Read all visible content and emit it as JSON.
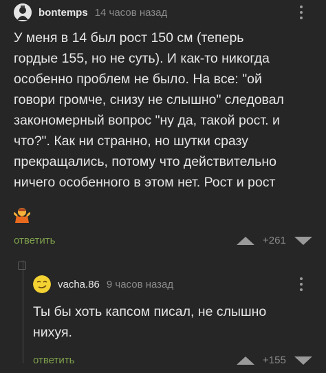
{
  "comment1": {
    "author": "bontemps",
    "time": "14 часов назад",
    "avatar_icon": "dark-character-avatar-icon",
    "lines": [
      "У меня в 14 был рост 150 см (теперь",
      "гордые 155, но не суть). И как-то никогда",
      "особенно проблем не было. На все: \"ой",
      "говори громче, снизу не слышно\" следовал",
      "закономерный вопрос \"ну да, такой рост. и",
      "что?\". Как ни странно, но шутки сразу",
      "прекращались, потому что действительно",
      "ничего особенного в этом нет. Рост и рост"
    ],
    "emoji_icon": "person-shrugging-emoji",
    "reply_label": "ответить",
    "rating": "+261"
  },
  "comment2": {
    "author": "vacha.86",
    "time": "9 часов назад",
    "avatar_icon": "smirking-face-avatar-icon",
    "lines": [
      "Ты бы хоть капсом писал, не слышно",
      "нихуя."
    ],
    "reply_label": "ответить",
    "rating": "+155"
  },
  "colors": {
    "background": "#262626",
    "text": "#e6e6e6",
    "meta": "#8a8a8a",
    "reply": "#7ea14c",
    "arrow": "#9a9a9a"
  }
}
